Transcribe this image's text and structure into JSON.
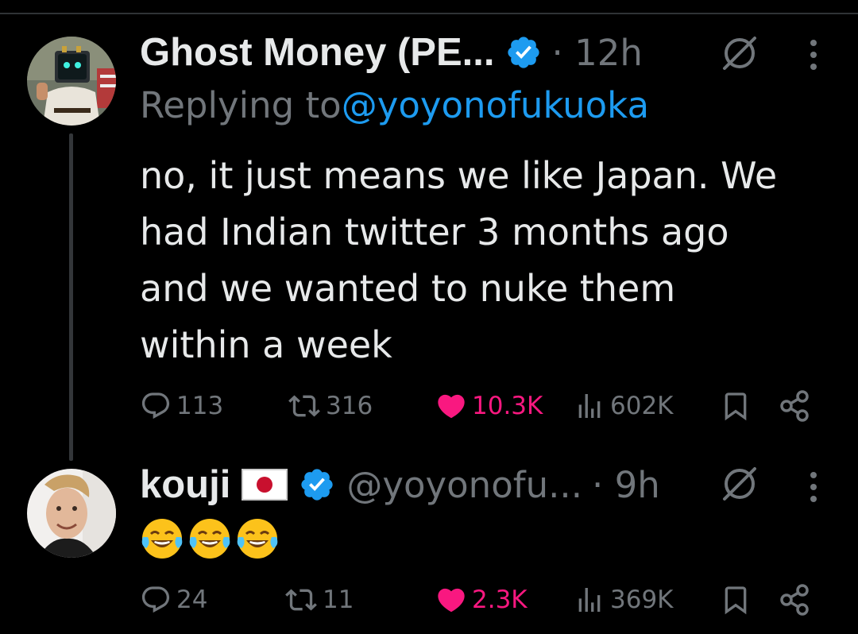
{
  "tweets": [
    {
      "name": "Ghost Money (PE...",
      "verified": true,
      "time": "· 12h",
      "replying_prefix": "Replying to ",
      "replying_handle": "@yoyonofukuoka",
      "text_lines": [
        "no, it just means we like Japan. We",
        "had Indian twitter 3 months ago",
        "and we wanted to nuke them",
        "within a week"
      ],
      "stats": {
        "replies": "113",
        "reposts": "316",
        "likes": "10.3K",
        "views": "602K"
      },
      "liked": true
    },
    {
      "name": "kouji",
      "flag": "japan-flag",
      "verified": true,
      "handle": "@yoyonofu...",
      "time": "· 9h",
      "emoji_text": "😂😂😂",
      "stats": {
        "replies": "24",
        "reposts": "11",
        "likes": "2.3K",
        "views": "369K"
      },
      "liked": true
    }
  ],
  "colors": {
    "background": "#000000",
    "text": "#e7e9ea",
    "muted": "#71767b",
    "link": "#1d9bf0",
    "like": "#f91880",
    "verified": "#1d9bf0"
  },
  "icons": [
    "reply-icon",
    "repost-icon",
    "like-icon",
    "views-icon",
    "bookmark-icon",
    "share-icon",
    "grok-icon",
    "more-icon",
    "verified-badge-icon"
  ]
}
